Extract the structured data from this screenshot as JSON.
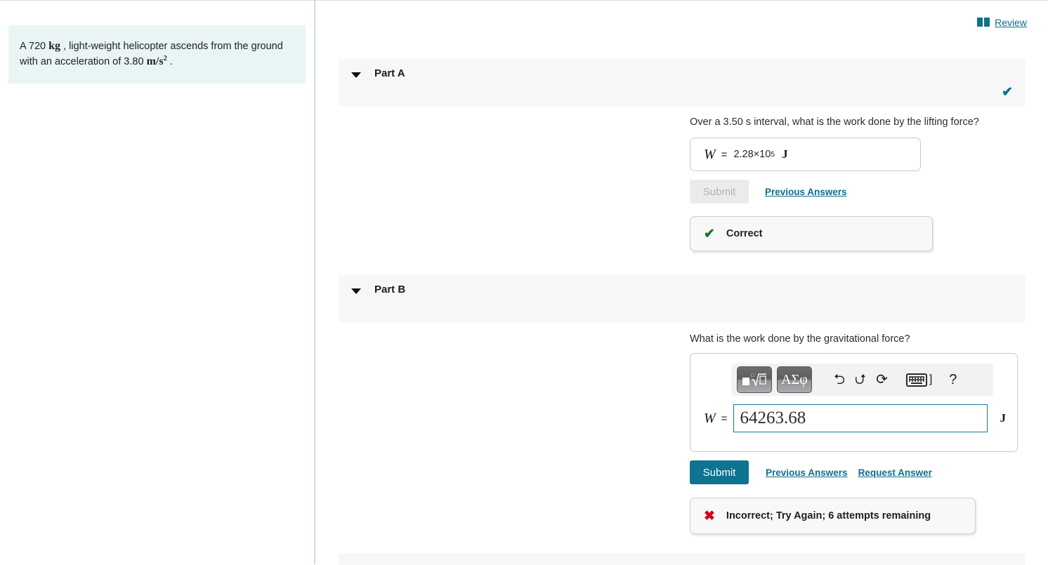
{
  "problem": {
    "prefix": "A 720",
    "unit_mass": "kg",
    "middle": ", light-weight helicopter ascends from the ground with an acceleration of 3.80",
    "unit_accel_base": "m/s",
    "unit_accel_exp": "2",
    "suffix": "."
  },
  "header": {
    "review_label": "Review",
    "review_icon": "book-icon"
  },
  "parts": [
    {
      "id": "a",
      "title": "Part A",
      "status_icon": "check-icon",
      "question": "Over a 3.50 s interval, what is the work done by the lifting force?",
      "answer": {
        "variable": "W",
        "equals": "=",
        "value_mantissa": "2.28×10",
        "value_exponent": "5",
        "unit": "J"
      },
      "submit_label": "Submit",
      "submit_enabled": false,
      "links": [
        "Previous Answers"
      ],
      "feedback": {
        "mark": "✔",
        "text": "Correct",
        "kind": "correct"
      }
    },
    {
      "id": "b",
      "title": "Part B",
      "question": "What is the work done by the gravitational force?",
      "toolbar": {
        "template_button": "template-sqrt-button",
        "greek_button": "ΑΣφ",
        "undo": "⮌",
        "redo": "⮍",
        "reset": "⟳",
        "keyboard": "keyboard-icon",
        "bracket": "]",
        "help": "?"
      },
      "answer": {
        "variable": "W",
        "equals": "=",
        "input_value": "64263.68",
        "input_placeholder": "",
        "unit": "J"
      },
      "submit_label": "Submit",
      "submit_enabled": true,
      "links": [
        "Previous Answers",
        "Request Answer"
      ],
      "feedback": {
        "mark": "✖",
        "text": "Incorrect; Try Again; 6 attempts remaining",
        "kind": "incorrect"
      }
    }
  ],
  "colors": {
    "accent_teal": "#0d7391",
    "link_teal": "#0e6e8c",
    "problem_bg": "#e9f5f4",
    "header_bg": "#f7f7f7",
    "correct_green": "#117a2e",
    "incorrect_red": "#d0021b"
  }
}
